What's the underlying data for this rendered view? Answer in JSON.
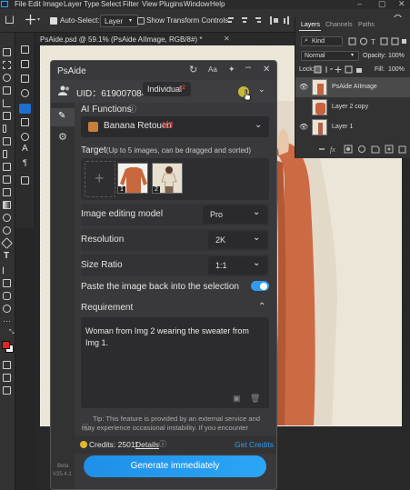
{
  "menubar": {
    "app_icon": "ps-logo-icon",
    "items": [
      "File",
      "Edit",
      "Image",
      "Layer",
      "Type",
      "Select",
      "Filter",
      "View",
      "Plugins",
      "Window",
      "Help"
    ]
  },
  "options_bar": {
    "auto_select_label": "Auto-Select:",
    "auto_select_value": "Layer",
    "show_transform_label": "Show Transform Controls"
  },
  "document": {
    "tab_title": "PsAide.psd @ 59.1% (PsAide AIImage, RGB/8#) *"
  },
  "layers_panel": {
    "tabs": [
      "Layers",
      "Channels",
      "Paths"
    ],
    "filter_label": "Kind",
    "blend_mode": "Normal",
    "opacity_label": "Opacity:",
    "opacity_value": "100%",
    "lock_label": "Lock:",
    "fill_label": "Fill:",
    "fill_value": "100%",
    "layers": [
      {
        "name": "PsAide AIImage",
        "visible": true,
        "selected": true
      },
      {
        "name": "Layer 2 copy",
        "visible": false,
        "selected": false
      },
      {
        "name": "Layer 1",
        "visible": true,
        "selected": false
      }
    ]
  },
  "plugin": {
    "title": "PsAide",
    "uid_label": "UID：619007084",
    "plan_label": "Individual",
    "plan_badge": "v2",
    "ai_functions_label": "AI Functions",
    "function_value": "Banana Retouch",
    "function_badge": "V3",
    "target_label": "Target",
    "target_hint": "(Up to 5 images, can be dragged and sorted)",
    "target_images": [
      {
        "index": "1"
      },
      {
        "index": "2"
      }
    ],
    "model_label": "Image editing model",
    "model_value": "Pro",
    "resolution_label": "Resolution",
    "resolution_value": "2K",
    "size_ratio_label": "Size Ratio",
    "size_ratio_value": "1:1",
    "paste_label": "Paste the image back into the selection",
    "paste_enabled": true,
    "requirement_label": "Requirement",
    "requirement_text": "Woman from Img 2 wearing the sweater from Img 1.",
    "tip_text": "Tip: This feature is provided by an external service and may experience occasional instability. If you encounter",
    "credits_label": "Credits: 25011",
    "details_label": "Details",
    "get_credits_label": "Get Credits",
    "generate_label": "Generate immediately",
    "version_label": "Beta",
    "version_number": "V25.4.1",
    "accent_color": "#2f9cf0",
    "badge_color": "#e0443c"
  }
}
